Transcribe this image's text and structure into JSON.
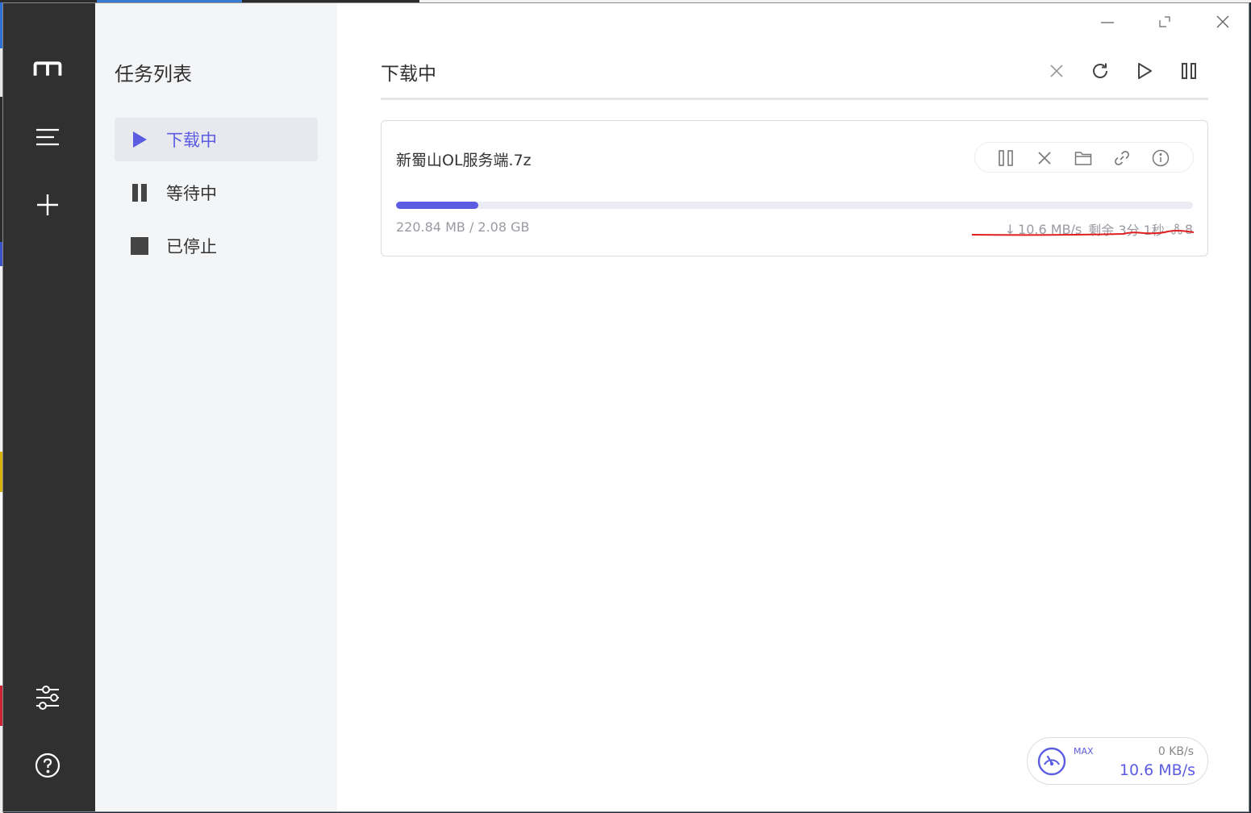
{
  "sidebar": {
    "title": "任务列表",
    "items": [
      {
        "label": "下载中",
        "active": true,
        "icon": "play-icon"
      },
      {
        "label": "等待中",
        "active": false,
        "icon": "pause-icon"
      },
      {
        "label": "已停止",
        "active": false,
        "icon": "stop-icon"
      }
    ]
  },
  "main": {
    "title": "下载中"
  },
  "task": {
    "name": "新蜀山OL服务端.7z",
    "size_text": "220.84 MB / 2.08 GB",
    "progress_fraction": 0.1035,
    "speed": "10.6 MB/s",
    "remaining": "剩余 3分 1秒",
    "connections": "8"
  },
  "speed_meter": {
    "max_label": "MAX",
    "upload": "0 KB/s",
    "download": "10.6 MB/s"
  },
  "colors": {
    "accent": "#5b5ce2",
    "rail": "#303030",
    "sidebar": "#f4f5f7",
    "annotation": "#e02020"
  }
}
